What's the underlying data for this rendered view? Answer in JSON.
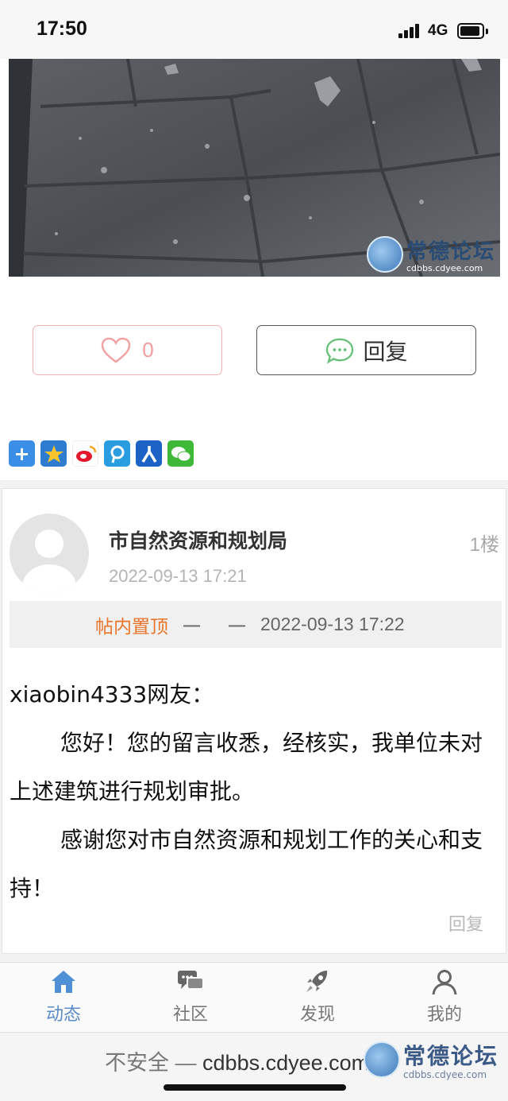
{
  "status_bar": {
    "time": "17:50",
    "network": "4G"
  },
  "post": {
    "photo_watermark": {
      "title": "常德论坛",
      "url": "cdbbs.cdyee.com"
    },
    "like_count": "0",
    "reply_label": "回复",
    "share_icons": [
      "plus-share-icon",
      "qzone-icon",
      "weibo-icon",
      "tencent-weibo-icon",
      "renren-icon",
      "wechat-icon"
    ]
  },
  "reply": {
    "author": "市自然资源和规划局",
    "floor": "1楼",
    "time": "2022-09-13 17:21",
    "notice": {
      "label": "帖内置顶",
      "dash1": "一",
      "dash2": "一",
      "time": "2022-09-13 17:22"
    },
    "body": {
      "greeting": "xiaobin4333网友：",
      "para1": "您好！您的留言收悉，经核实，我单位未对上述建筑进行规划审批。",
      "para2": "感谢您对市自然资源和规划工作的关心和支持！"
    },
    "reply_link": "回复"
  },
  "tab_bar": {
    "tabs": [
      {
        "label": "动态",
        "icon": "home-icon",
        "active": true
      },
      {
        "label": "社区",
        "icon": "chat-icon",
        "active": false
      },
      {
        "label": "发现",
        "icon": "rocket-icon",
        "active": false
      },
      {
        "label": "我的",
        "icon": "user-icon",
        "active": false
      }
    ],
    "active_color": "#5a8cc9"
  },
  "browser": {
    "insecure_label": "不安全",
    "separator": "—",
    "url": "cdbbs.cdyee.com",
    "watermark": {
      "title": "常德论坛",
      "url": "cdbbs.cdyee.com"
    }
  }
}
